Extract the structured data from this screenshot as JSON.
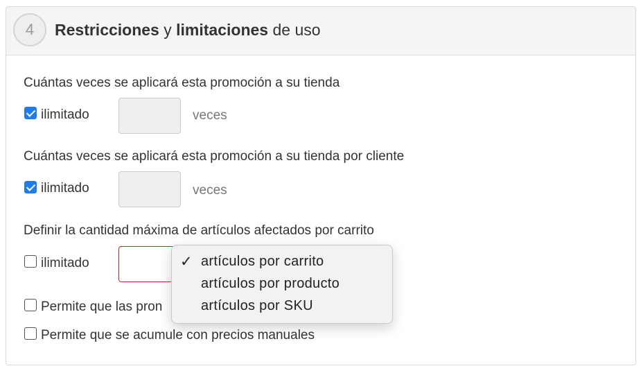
{
  "header": {
    "step": "4",
    "title_bold_1": "Restricciones",
    "title_mid": " y ",
    "title_bold_2": "limitaciones",
    "title_end": " de uso"
  },
  "rows": [
    {
      "label": "Cuántas veces se aplicará esta promoción a su tienda",
      "checkbox_label": "ilimitado",
      "checked": true,
      "unit": "veces"
    },
    {
      "label": "Cuántas veces se aplicará esta promoción a su tienda por cliente",
      "checkbox_label": "ilimitado",
      "checked": true,
      "unit": "veces"
    },
    {
      "label": "Definir la cantidad máxima de artículos afectados por carrito",
      "checkbox_label": "ilimitado",
      "checked": false
    }
  ],
  "dropdown": {
    "options": [
      "artículos por carrito",
      "artículos por producto",
      "artículos por SKU"
    ],
    "selected_index": 0,
    "check_glyph": "✓"
  },
  "extra_checkboxes": [
    {
      "label": "Permite que las pron",
      "checked": false
    },
    {
      "label": "Permite que se acumule con precios manuales",
      "checked": false
    }
  ],
  "colors": {
    "checkbox_accent": "#1f7cf0",
    "error_border": "#e02020"
  }
}
